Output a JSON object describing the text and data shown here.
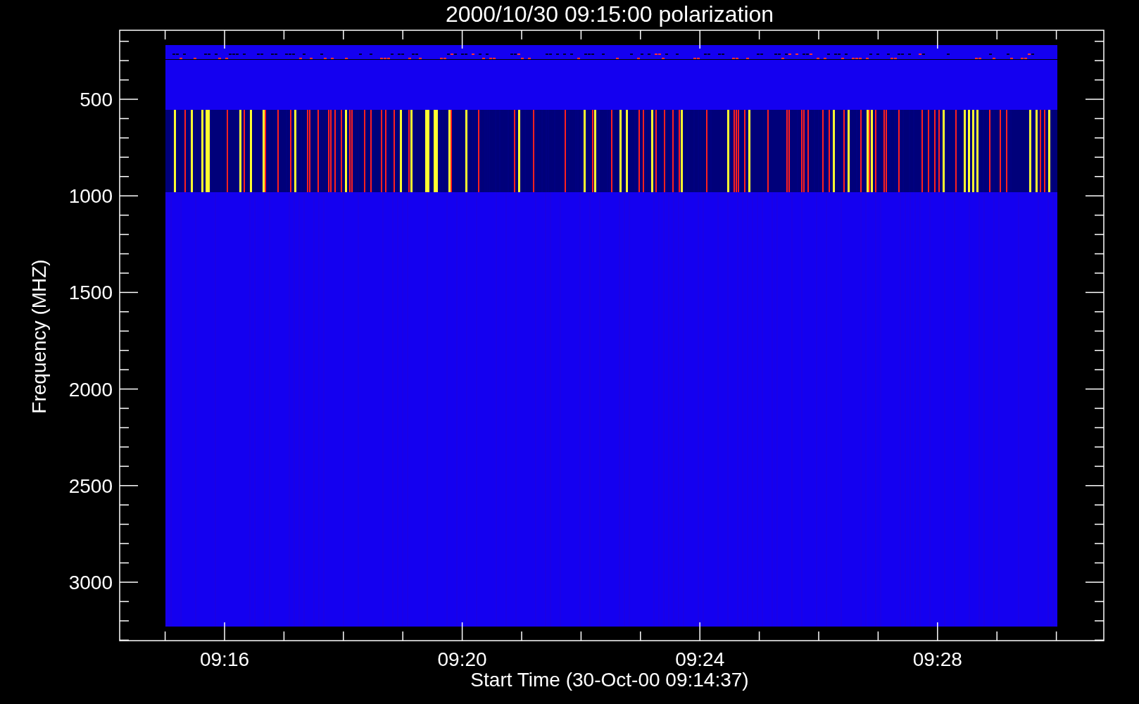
{
  "plot": {
    "title": "2000/10/30 09:15:00 polarization",
    "y_axis": {
      "label": "Frequency (MHZ)",
      "ticks": [
        "500",
        "1000",
        "1500",
        "2000",
        "2500",
        "3000"
      ]
    },
    "x_axis": {
      "label": "Start Time (30-Oct-00 09:14:37)",
      "ticks": [
        "09:16",
        "09:20",
        "09:24",
        "09:28"
      ]
    }
  }
}
